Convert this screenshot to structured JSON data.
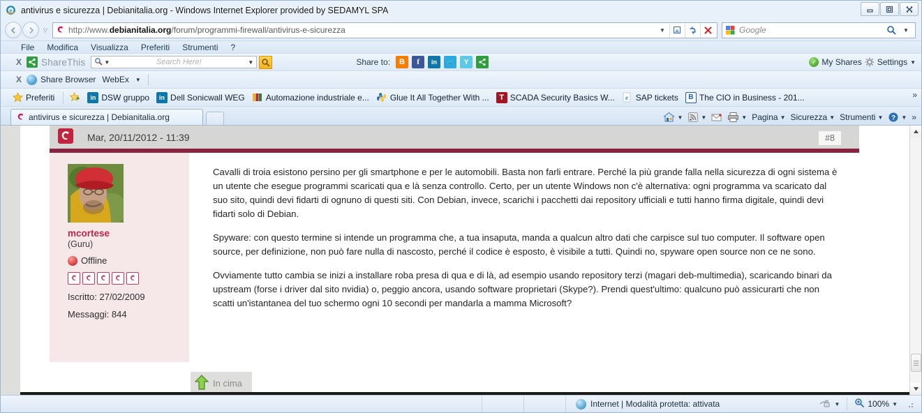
{
  "window": {
    "title": "antivirus e sicurezza | Debianitalia.org - Windows Internet Explorer provided by SEDAMYL SPA",
    "minimize_label": "━",
    "restore_label": "❐",
    "close_label": "✖"
  },
  "address_bar": {
    "back_label": "◀",
    "forward_label": "▶",
    "history_caret": "▽",
    "url_scheme": "http://www.",
    "url_domain": "debianitalia.org",
    "url_path": "/forum/programmi-firewall/antivirus-e-sicurezza",
    "url_dropdown_caret": "▼",
    "compat_icon": "compatibility-view-icon",
    "refresh_label": "↻",
    "stop_label": "✕",
    "search_placeholder": "Google",
    "search_go_label": "⌕",
    "search_caret": "▼"
  },
  "menu": {
    "items": [
      "File",
      "Modifica",
      "Visualizza",
      "Preferiti",
      "Strumenti",
      "?"
    ]
  },
  "sharethis_toolbar": {
    "close_label": "X",
    "brand": "ShareThis",
    "brand_sup": "·",
    "search_placeholder": "Search Here!",
    "search_caret": "▼",
    "engine_caret": "▼",
    "go_label": "⌕",
    "share_to_label": "Share to:",
    "share_icons": [
      {
        "name": "blogger-icon",
        "glyph": "B",
        "color": "#f57d00"
      },
      {
        "name": "facebook-icon",
        "glyph": "f",
        "color": "#3b5998"
      },
      {
        "name": "linkedin-icon",
        "glyph": "in",
        "color": "#0e76a8"
      },
      {
        "name": "twitter-icon",
        "glyph": "🐦",
        "color": "#2daae1"
      },
      {
        "name": "yammer-icon",
        "glyph": "Y",
        "color": "#5ec8e8"
      },
      {
        "name": "sharethis-icon",
        "glyph": "⮀",
        "color": "#2e9e3f"
      }
    ],
    "my_shares_label": "My Shares",
    "settings_label": "Settings",
    "settings_caret": "▼"
  },
  "webex_toolbar": {
    "close_label": "X",
    "share_browser_label": "Share Browser",
    "webex_label": "WebEx",
    "webex_caret": "▼"
  },
  "favorites_bar": {
    "favorites_label": "Preferiti",
    "items": [
      {
        "label": "DSW gruppo",
        "icon": "linkedin-icon",
        "glyph": "in",
        "color": "#0e76a8"
      },
      {
        "label": "Dell Sonicwall WEG",
        "icon": "linkedin-icon",
        "glyph": "in",
        "color": "#0e76a8"
      },
      {
        "label": "Automazione industriale e...",
        "icon": "site-icon",
        "glyph": "▌",
        "color": "#e8b33a"
      },
      {
        "label": "Glue It All Together With ...",
        "icon": "python-icon",
        "glyph": "◑",
        "color": "#3572a5"
      },
      {
        "label": "SCADA Security Basics W...",
        "icon": "tofino-icon",
        "glyph": "T",
        "color": "#a31621"
      },
      {
        "label": "SAP tickets",
        "icon": "ie-icon",
        "glyph": "e",
        "color": "#ffffff"
      },
      {
        "label": "The CIO in Business - 201...",
        "icon": "brighttalk-icon",
        "glyph": "B",
        "color": "#1a5fa8"
      }
    ],
    "overflow_caret": "»"
  },
  "tabs": {
    "active": {
      "label": "antivirus e sicurezza | Debianitalia.org",
      "icon": "debian-swirl-icon"
    },
    "new_tab_label": ""
  },
  "command_bar": {
    "items": [
      {
        "name": "home-button",
        "label": "",
        "icon": "home-icon",
        "caret": "▼"
      },
      {
        "name": "feeds-button",
        "label": "",
        "icon": "rss-icon",
        "caret": "▼"
      },
      {
        "name": "mail-button",
        "label": "",
        "icon": "mail-icon",
        "caret": ""
      },
      {
        "name": "print-button",
        "label": "",
        "icon": "printer-icon",
        "caret": "▼"
      },
      {
        "name": "page-menu",
        "label": "Pagina",
        "icon": "",
        "caret": "▼"
      },
      {
        "name": "security-menu",
        "label": "Sicurezza",
        "icon": "",
        "caret": "▼"
      },
      {
        "name": "tools-menu",
        "label": "Strumenti",
        "icon": "",
        "caret": "▼"
      },
      {
        "name": "help-menu",
        "label": "",
        "icon": "help-icon",
        "caret": "▼"
      }
    ],
    "overflow_caret": "»"
  },
  "post": {
    "date": "Mar, 20/11/2012 - 11:39",
    "number": "#8",
    "avatar_alt": "user-avatar",
    "username": "mcortese",
    "rank": "(Guru)",
    "status": "Offline",
    "badge_count": 5,
    "joined": "Iscritto: 27/02/2009",
    "messages": "Messaggi: 844",
    "paragraphs": [
      "Cavalli di troia esistono persino per gli smartphone e per le automobili. Basta non farli entrare. Perché la più grande falla nella sicurezza di ogni sistema è un utente che esegue programmi scaricati qua e là senza controllo. Certo, per un utente Windows non c'è alternativa: ogni programma va scaricato dal suo sito, quindi devi fidarti di ognuno di questi siti. Con Debian, invece, scarichi i pacchetti dai repository ufficiali e tutti hanno firma digitale, quindi devi fidarti solo di Debian.",
      "Spyware: con questo termine si intende un programma che, a tua insaputa, manda a qualcun altro dati che carpisce sul tuo computer. Il software open source, per definizione, non può fare nulla di nascosto, perché il codice è esposto, è visibile a tutti. Quindi no, spyware open source non ce ne sono.",
      "Ovviamente tutto cambia se inizi a installare roba presa di qua e di là, ad esempio usando repository terzi (magari deb-multimedia), scaricando binari da upstream (forse i driver dal sito nvidia) o, peggio ancora, usando software proprietari (Skype?). Prendi quest'ultimo: qualcuno può assicurarti che non scatti un'istantanea del tuo schermo ogni 10 secondi per mandarla a mamma Microsoft?"
    ],
    "back_to_top_label": "In cima"
  },
  "scrollbar": {
    "up_label": "▲",
    "down_label": "▼"
  },
  "status_bar": {
    "zone_text": "Internet | Modalità protetta: attivata",
    "privacy_caret": "▼",
    "zoom_level": "100%",
    "zoom_caret": "▼"
  },
  "colors": {
    "accent_red": "#8c2340",
    "username_red": "#b9284b",
    "user_panel_bg": "#f6e7e9"
  }
}
